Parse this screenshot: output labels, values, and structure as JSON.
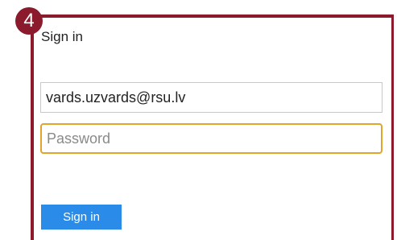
{
  "badge": {
    "number": "4"
  },
  "form": {
    "title": "Sign in",
    "email_value": "vards.uzvards@rsu.lv",
    "password_placeholder": "Password",
    "signin_label": "Sign in"
  },
  "colors": {
    "frame": "#8a1a2c",
    "focus_border": "#e0a52a",
    "button": "#2b8be8"
  }
}
